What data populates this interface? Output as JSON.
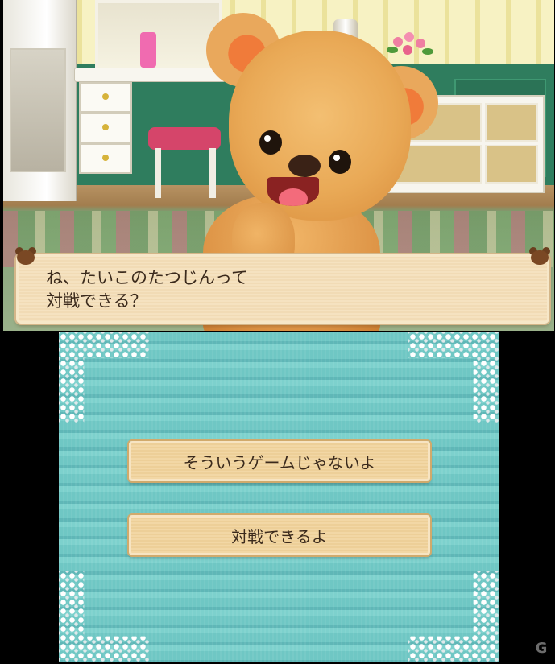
{
  "top_screen": {
    "dialogue": {
      "text": "ね、たいこのたつじんって\n対戦できる？"
    }
  },
  "bottom_screen": {
    "choices": [
      {
        "label": "そういうゲームじゃないよ"
      },
      {
        "label": "対戦できるよ"
      }
    ]
  },
  "watermark": {
    "icon": "site-logo-icon",
    "text": "G"
  },
  "colors": {
    "dialogue_bg": "#f3dfba",
    "button_bg": "#f0d39f",
    "text": "#3b2a1c",
    "bottom_bg": "#6fc7c4"
  }
}
